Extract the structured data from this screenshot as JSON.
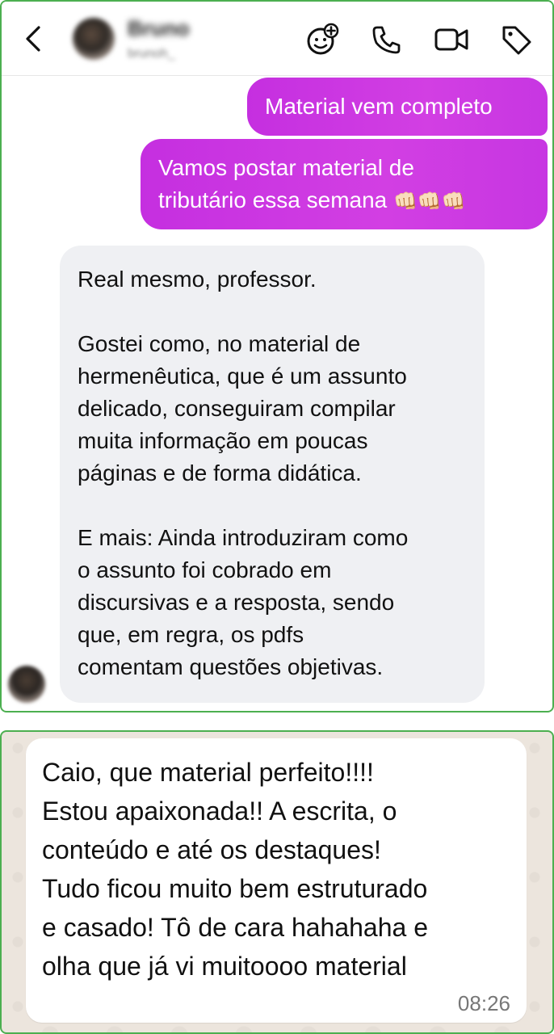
{
  "instagram": {
    "header": {
      "contact_name": "Bruno",
      "contact_handle": "brunoh_"
    },
    "messages_out": [
      {
        "line1": "Material vem completo"
      },
      {
        "line1": "Vamos postar material de",
        "line2": "tributário essa semana",
        "emoji": "👊🏻👊🏻👊🏻"
      }
    ],
    "message_in": {
      "paragraphs": [
        [
          "Real mesmo, professor."
        ],
        [
          "Gostei como, no material de",
          "hermenêutica, que é um assunto",
          "delicado, conseguiram compilar",
          "muita informação em poucas",
          "páginas e de forma didática."
        ],
        [
          "E mais: Ainda introduziram como",
          "o assunto foi cobrado em",
          "discursivas e a resposta, sendo",
          "que, em regra, os pdfs",
          "comentam questões objetivas."
        ]
      ]
    }
  },
  "whatsapp": {
    "message_lines": [
      "Caio, que material perfeito!!!!",
      "Estou apaixonada!! A escrita, o",
      "conteúdo e até os destaques!",
      "Tudo ficou muito bem estruturado",
      "e casado! Tô de cara hahahaha e",
      "olha que já vi muitoooo material"
    ],
    "time": "08:26"
  },
  "colors": {
    "outgoing_bubble": "#c936e2",
    "incoming_bubble": "#eff0f3",
    "panel_border": "#4caf50",
    "whatsapp_bg": "#ece5dd"
  },
  "icons": [
    "back-chevron-icon",
    "add-emoji-icon",
    "phone-icon",
    "video-camera-icon",
    "tag-icon"
  ]
}
